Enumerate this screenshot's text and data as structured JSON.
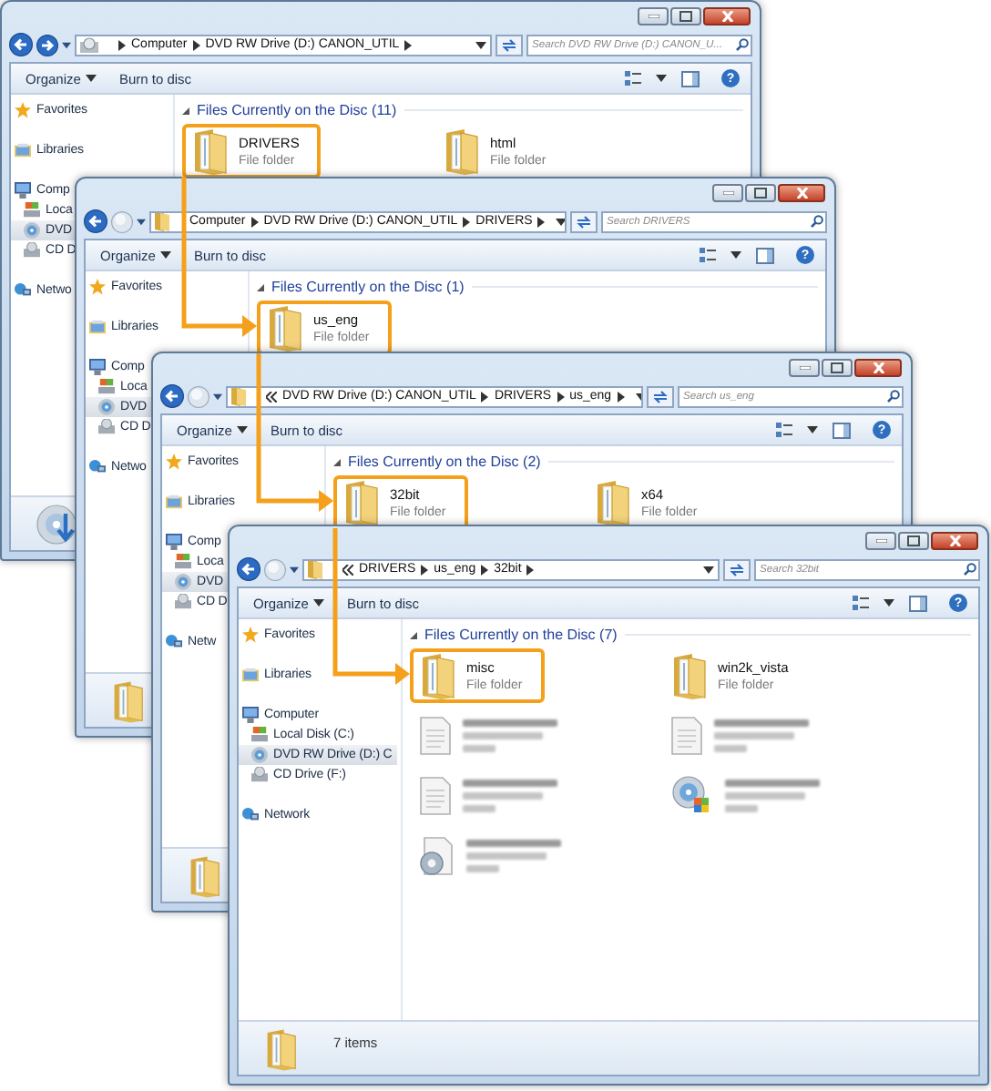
{
  "windows": [
    {
      "forward_enabled": true,
      "address": {
        "kind": "drive",
        "crumbs": [
          "Computer",
          "DVD RW Drive (D:) CANON_UTIL"
        ]
      },
      "search": {
        "placeholder": "Search DVD RW Drive (D:) CANON_U..."
      },
      "toolbar": {
        "organize": "Organize",
        "burn": "Burn to disc",
        "help": "?"
      },
      "sidebar": [
        {
          "kind": "favorites",
          "label": "Favorites",
          "selected": false
        },
        {
          "kind": "libraries",
          "label": "Libraries",
          "selected": false
        },
        {
          "kind": "computer",
          "label": "Comp",
          "selected": false,
          "children": [
            {
              "kind": "disk",
              "label": "Loca",
              "selected": false
            },
            {
              "kind": "dvd",
              "label": "DVD",
              "selected": true
            },
            {
              "kind": "cd",
              "label": "CD D",
              "selected": false
            }
          ]
        },
        {
          "kind": "network",
          "label": "Netwo",
          "selected": false
        }
      ],
      "section": "Files Currently on the Disc (11)",
      "items": [
        {
          "kind": "folder",
          "name": "DRIVERS",
          "type": "File folder",
          "highlighted": true
        },
        {
          "kind": "folder",
          "name": "html",
          "type": "File folder",
          "highlighted": false
        }
      ],
      "footer": {
        "kind": "drive"
      }
    },
    {
      "forward_enabled": false,
      "address": {
        "kind": "folder",
        "crumbs": [
          "Computer",
          "DVD RW Drive (D:) CANON_UTIL",
          "DRIVERS"
        ]
      },
      "search": {
        "placeholder": "Search DRIVERS"
      },
      "toolbar": {
        "organize": "Organize",
        "burn": "Burn to disc",
        "help": "?"
      },
      "sidebar": [
        {
          "kind": "favorites",
          "label": "Favorites",
          "selected": false
        },
        {
          "kind": "libraries",
          "label": "Libraries",
          "selected": false
        },
        {
          "kind": "computer",
          "label": "Comp",
          "selected": false,
          "children": [
            {
              "kind": "disk",
              "label": "Loca",
              "selected": false
            },
            {
              "kind": "dvd",
              "label": "DVD",
              "selected": true
            },
            {
              "kind": "cd",
              "label": "CD D",
              "selected": false
            }
          ]
        },
        {
          "kind": "network",
          "label": "Netwo",
          "selected": false
        }
      ],
      "section": "Files Currently on the Disc (1)",
      "items": [
        {
          "kind": "folder",
          "name": "us_eng",
          "type": "File folder",
          "highlighted": true
        }
      ],
      "footer": {
        "kind": "folder"
      }
    },
    {
      "forward_enabled": false,
      "address": {
        "kind": "overflow",
        "crumbs": [
          "DVD RW Drive (D:) CANON_UTIL",
          "DRIVERS",
          "us_eng"
        ]
      },
      "search": {
        "placeholder": "Search us_eng"
      },
      "toolbar": {
        "organize": "Organize",
        "burn": "Burn to disc",
        "help": "?"
      },
      "sidebar": [
        {
          "kind": "favorites",
          "label": "Favorites",
          "selected": false
        },
        {
          "kind": "libraries",
          "label": "Libraries",
          "selected": false
        },
        {
          "kind": "computer",
          "label": "Comp",
          "selected": false,
          "children": [
            {
              "kind": "disk",
              "label": "Loca",
              "selected": false
            },
            {
              "kind": "dvd",
              "label": "DVD",
              "selected": true
            },
            {
              "kind": "cd",
              "label": "CD D",
              "selected": false
            }
          ]
        },
        {
          "kind": "network",
          "label": "Netw",
          "selected": false
        }
      ],
      "section": "Files Currently on the Disc (2)",
      "items": [
        {
          "kind": "folder",
          "name": "32bit",
          "type": "File folder",
          "highlighted": true
        },
        {
          "kind": "folder",
          "name": "x64",
          "type": "File folder",
          "highlighted": false
        }
      ],
      "footer": {
        "kind": "folder"
      }
    },
    {
      "forward_enabled": false,
      "address": {
        "kind": "overflow",
        "crumbs": [
          "DRIVERS",
          "us_eng",
          "32bit"
        ]
      },
      "search": {
        "placeholder": "Search 32bit"
      },
      "toolbar": {
        "organize": "Organize",
        "burn": "Burn to disc",
        "help": "?"
      },
      "sidebar": [
        {
          "kind": "favorites",
          "label": "Favorites",
          "selected": false
        },
        {
          "kind": "libraries",
          "label": "Libraries",
          "selected": false
        },
        {
          "kind": "computer",
          "label": "Computer",
          "selected": false,
          "children": [
            {
              "kind": "disk",
              "label": "Local Disk (C:)",
              "selected": false
            },
            {
              "kind": "dvd",
              "label": "DVD RW Drive (D:) C",
              "selected": true
            },
            {
              "kind": "cd",
              "label": "CD Drive (F:)",
              "selected": false
            }
          ]
        },
        {
          "kind": "network",
          "label": "Network",
          "selected": false
        }
      ],
      "section": "Files Currently on the Disc (7)",
      "items": [
        {
          "kind": "folder",
          "name": "misc",
          "type": "File folder",
          "highlighted": true
        },
        {
          "kind": "folder",
          "name": "win2k_vista",
          "type": "File folder",
          "highlighted": false
        },
        {
          "kind": "document",
          "highlighted": false
        },
        {
          "kind": "document",
          "highlighted": false
        },
        {
          "kind": "document",
          "highlighted": false
        },
        {
          "kind": "installer",
          "highlighted": false
        },
        {
          "kind": "settings",
          "highlighted": false
        }
      ],
      "footer": {
        "kind": "folder",
        "text": "7 items"
      }
    }
  ]
}
